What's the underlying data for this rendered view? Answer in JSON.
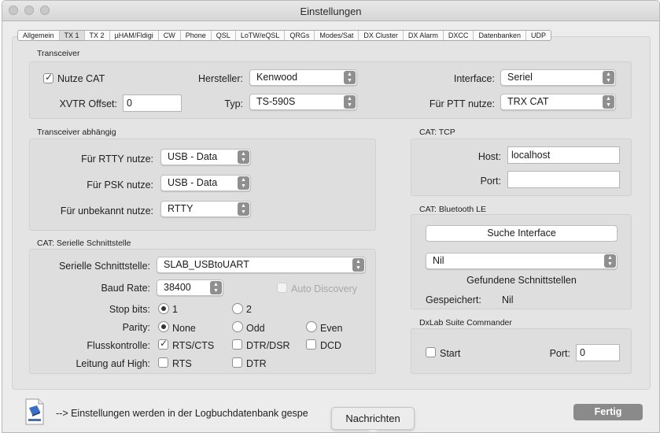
{
  "window": {
    "title": "Einstellungen"
  },
  "tabs": [
    "Allgemein",
    "TX 1",
    "TX 2",
    "µHAM/Fldigi",
    "CW",
    "Phone",
    "QSL",
    "LoTW/eQSL",
    "QRGs",
    "Modes/Sat",
    "DX Cluster",
    "DX Alarm",
    "DXCC",
    "Datenbanken",
    "UDP"
  ],
  "active_tab": "TX 1",
  "transceiver": {
    "title": "Transceiver",
    "use_cat_label": "Nutze CAT",
    "use_cat_checked": true,
    "hersteller_label": "Hersteller:",
    "hersteller_value": "Kenwood",
    "interface_label": "Interface:",
    "interface_value": "Seriel",
    "xvtr_label": "XVTR Offset:",
    "xvtr_value": "0",
    "typ_label": "Typ:",
    "typ_value": "TS-590S",
    "ptt_label": "Für PTT nutze:",
    "ptt_value": "TRX CAT"
  },
  "abhaengig": {
    "title": "Transceiver abhängig",
    "rtty_label": "Für RTTY nutze:",
    "rtty_value": "USB - Data",
    "psk_label": "Für PSK nutze:",
    "psk_value": "USB - Data",
    "unbekannt_label": "Für unbekannt nutze:",
    "unbekannt_value": "RTTY"
  },
  "cat_tcp": {
    "title": "CAT: TCP",
    "host_label": "Host:",
    "host_value": "localhost",
    "port_label": "Port:",
    "port_value": ""
  },
  "bluetooth": {
    "title": "CAT: Bluetooth LE",
    "search_button": "Suche Interface",
    "interface_value": "Nil",
    "found_label": "Gefundene Schnittstellen",
    "saved_label": "Gespeichert:",
    "saved_value": "Nil"
  },
  "serial": {
    "title": "CAT: Serielle Schnittstelle",
    "port_label": "Serielle Schnittstelle:",
    "port_value": "SLAB_USBtoUART",
    "baud_label": "Baud Rate:",
    "baud_value": "38400",
    "auto_label": "Auto Discovery",
    "stop_label": "Stop bits:",
    "stop_1": "1",
    "stop_2": "2",
    "parity_label": "Parity:",
    "parity_none": "None",
    "parity_odd": "Odd",
    "parity_even": "Even",
    "flow_label": "Flusskontrolle:",
    "flow_rts": "RTS/CTS",
    "flow_dtr": "DTR/DSR",
    "flow_dcd": "DCD",
    "high_label": "Leitung auf High:",
    "high_rts": "RTS",
    "high_dtr": "DTR"
  },
  "dxlab": {
    "title": "DxLab Suite Commander",
    "start_label": "Start",
    "port_label": "Port:",
    "port_value": "0"
  },
  "footer": {
    "info": "--> Einstellungen werden in der Logbuchdatenbank gespe",
    "done_button": "Fertig",
    "tooltip": "Nachrichten"
  }
}
